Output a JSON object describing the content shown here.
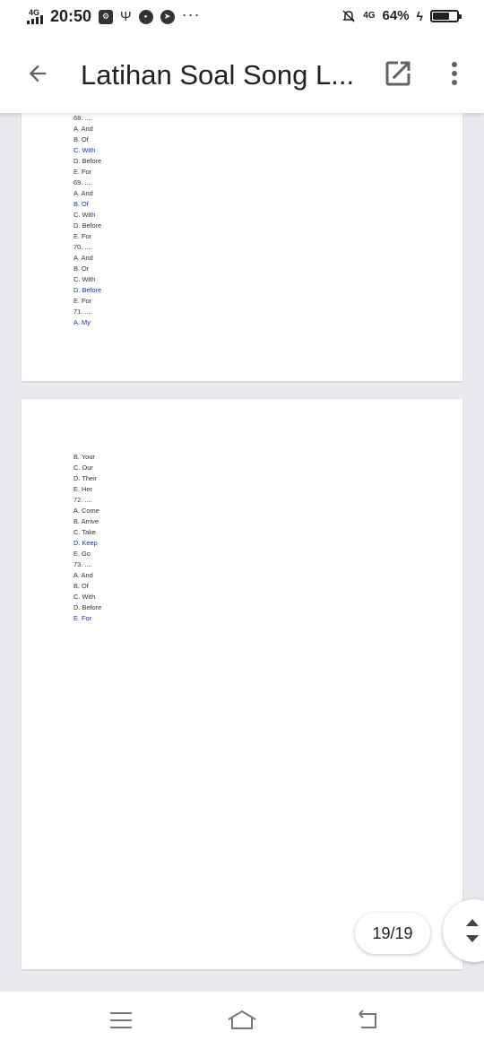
{
  "status": {
    "network": "4G",
    "time": "20:50",
    "right_network": "4G",
    "battery": "64%",
    "battery_level": 0.64,
    "icons": [
      "usb-debug-icon",
      "usb-icon",
      "line-app-icon",
      "telegram-icon",
      "more-dots-icon"
    ]
  },
  "toolbar": {
    "title": "Latihan Soal Song L...",
    "back_icon": "arrow-left-icon",
    "open_icon": "open-in-new-icon",
    "more_icon": "more-vert-icon"
  },
  "pages": [
    {
      "lines": [
        {
          "text": "68. ....",
          "highlight": false
        },
        {
          "text": "A. And",
          "highlight": false
        },
        {
          "text": "B. Of",
          "highlight": false
        },
        {
          "text": "C. With",
          "highlight": true
        },
        {
          "text": "D. Before",
          "highlight": false
        },
        {
          "text": "E. For",
          "highlight": false
        },
        {
          "text": "69. ....",
          "highlight": false
        },
        {
          "text": "A. And",
          "highlight": false
        },
        {
          "text": "B. Of",
          "highlight": true
        },
        {
          "text": "C. With",
          "highlight": false
        },
        {
          "text": "D. Before",
          "highlight": false
        },
        {
          "text": "E. For",
          "highlight": false
        },
        {
          "text": "70. ....",
          "highlight": false
        },
        {
          "text": "A. And",
          "highlight": false
        },
        {
          "text": "B. Or",
          "highlight": false
        },
        {
          "text": "C. With",
          "highlight": false
        },
        {
          "text": "D. Before",
          "highlight": true
        },
        {
          "text": "E. For",
          "highlight": false
        },
        {
          "text": "71. ....",
          "highlight": false
        },
        {
          "text": "A. My",
          "highlight": true
        }
      ]
    },
    {
      "lines": [
        {
          "text": "B. Your",
          "highlight": false
        },
        {
          "text": "C. Our",
          "highlight": false
        },
        {
          "text": "D. Their",
          "highlight": false
        },
        {
          "text": "E. Her",
          "highlight": false
        },
        {
          "text": "72. ....",
          "highlight": false
        },
        {
          "text": "A. Come",
          "highlight": false
        },
        {
          "text": "B. Arrive",
          "highlight": false
        },
        {
          "text": "C. Take",
          "highlight": false
        },
        {
          "text": "D. Keep",
          "highlight": true
        },
        {
          "text": "E. Go",
          "highlight": false
        },
        {
          "text": "73. ....",
          "highlight": false
        },
        {
          "text": "A. And",
          "highlight": false
        },
        {
          "text": "B. Of",
          "highlight": false
        },
        {
          "text": "C. With",
          "highlight": false
        },
        {
          "text": "D. Before",
          "highlight": false
        },
        {
          "text": "E. For",
          "highlight": true
        }
      ]
    }
  ],
  "page_counter": "19/19",
  "colors": {
    "highlight": "#1a2dcc",
    "text": "#333333",
    "background": "#e9eaed"
  },
  "navbar": {
    "icons": [
      "menu-icon",
      "home-icon",
      "back-icon"
    ]
  }
}
